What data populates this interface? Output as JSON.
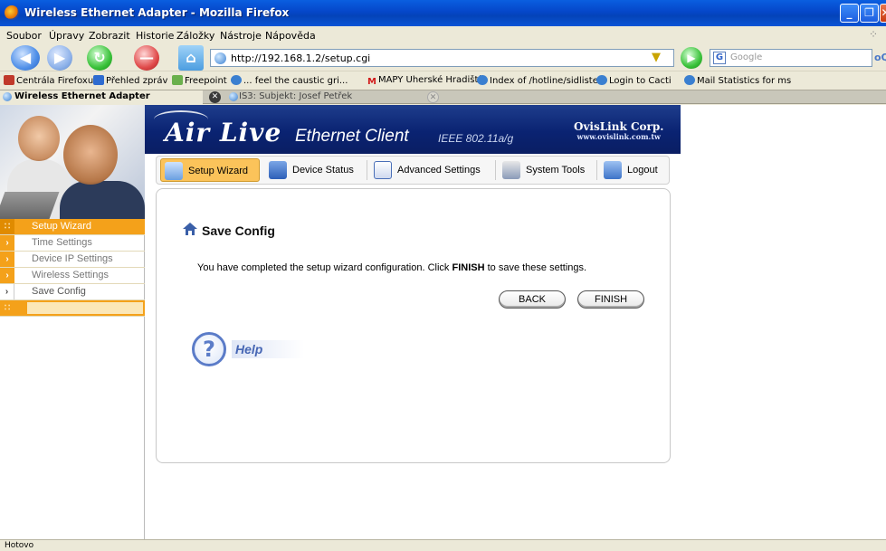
{
  "window": {
    "title": "Wireless Ethernet Adapter - Mozilla Firefox"
  },
  "menu": [
    "Soubor",
    "Úpravy",
    "Zobrazit",
    "Historie",
    "Záložky",
    "Nástroje",
    "Nápověda"
  ],
  "nav": {
    "url": "http://192.168.1.2/setup.cgi",
    "search_placeholder": "Google"
  },
  "bookmarks": [
    {
      "label": "Centrála Firefoxu",
      "color": "#c0392b"
    },
    {
      "label": "Přehled zpráv",
      "color": "#2e6bd0"
    },
    {
      "label": "Freepoint",
      "color": "#6ab04c"
    },
    {
      "label": "... feel the caustic gri...",
      "color": "#3a7fd0"
    },
    {
      "label": "MAPY Uherské Hradiště",
      "color": "#d11a1a"
    },
    {
      "label": "Index of /hotline/sidliste",
      "color": "#3a7fd0"
    },
    {
      "label": "Login to Cacti",
      "color": "#3a7fd0"
    },
    {
      "label": "Mail Statistics for ms",
      "color": "#3a7fd0"
    }
  ],
  "tabs": [
    {
      "label": "Wireless Ethernet Adapter",
      "active": true
    },
    {
      "label": "IS3: Subjekt: Josef Petřek",
      "active": false
    }
  ],
  "sidebar": {
    "items": [
      {
        "label": "Setup Wizard",
        "state": "active"
      },
      {
        "label": "Time Settings",
        "state": "normal"
      },
      {
        "label": "Device IP Settings",
        "state": "normal"
      },
      {
        "label": "Wireless Settings",
        "state": "normal"
      },
      {
        "label": "Save Config",
        "state": "current"
      }
    ]
  },
  "banner": {
    "logo": "Air Live",
    "product": "Ethernet Client",
    "standard": "IEEE 802.11a/g",
    "corp": "OvisLink Corp.",
    "corp_url": "www.ovislink.com.tw"
  },
  "topmenu": [
    {
      "label": "Setup Wizard",
      "selected": true
    },
    {
      "label": "Device Status",
      "selected": false
    },
    {
      "label": "Advanced Settings",
      "selected": false
    },
    {
      "label": "System Tools",
      "selected": false
    },
    {
      "label": "Logout",
      "selected": false
    }
  ],
  "main": {
    "title": "Save Config",
    "message_pre": "You have completed the setup wizard configuration. Click ",
    "message_bold": "FINISH",
    "message_post": " to save these settings.",
    "back_label": "BACK",
    "finish_label": "FINISH",
    "help_label": "Help"
  },
  "status": {
    "text": "Hotovo"
  },
  "colors": {
    "accent_orange": "#f4a11a",
    "tab_selected": "#fbc35a",
    "banner_blue": "#0a2372",
    "xp_title": "#0546c9"
  }
}
